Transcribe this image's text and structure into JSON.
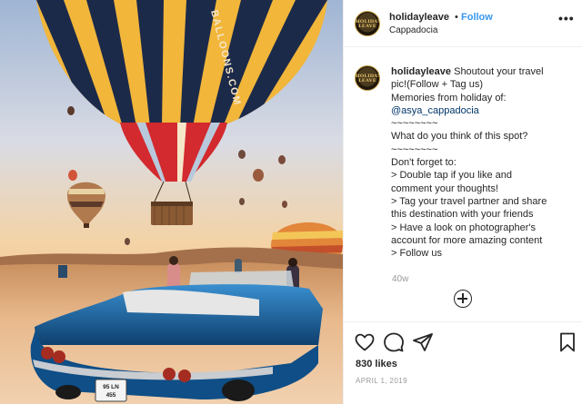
{
  "post": {
    "username": "holidayleave",
    "separator": "•",
    "follow_label": "Follow",
    "location": "Cappadocia",
    "avatar_text": "HOLIDAY LEAVE",
    "more_label": "•••"
  },
  "photo": {
    "balloon_text": "BALLOONS.COM",
    "plate_text": [
      "95 LN",
      "455"
    ]
  },
  "caption": {
    "username": "holidayleave",
    "lines": [
      " Shoutout your travel",
      "pic!(Follow + Tag us)",
      "Memories from holiday of:",
      "@asya_cappadocia",
      "~~~~~~~~",
      "What do you think of this spot?",
      "~~~~~~~~",
      "Don't forget to:",
      "> Double tap if you like and",
      "comment your thoughts!",
      "> Tag your travel partner and share",
      "this destination with your friends",
      "> Have a look on photographer's",
      "account for more amazing content",
      "> Follow us"
    ],
    "time_ago": "40w"
  },
  "icons": {
    "like": "heart-icon",
    "comment": "comment-icon",
    "share": "send-icon",
    "save": "bookmark-icon",
    "load_more": "plus-circle-icon"
  },
  "stats": {
    "likes": "830 likes",
    "date": "APRIL 1, 2019"
  },
  "colors": {
    "follow": "#3897f0",
    "mention": "#003569",
    "muted": "#999999",
    "border": "#efefef"
  }
}
